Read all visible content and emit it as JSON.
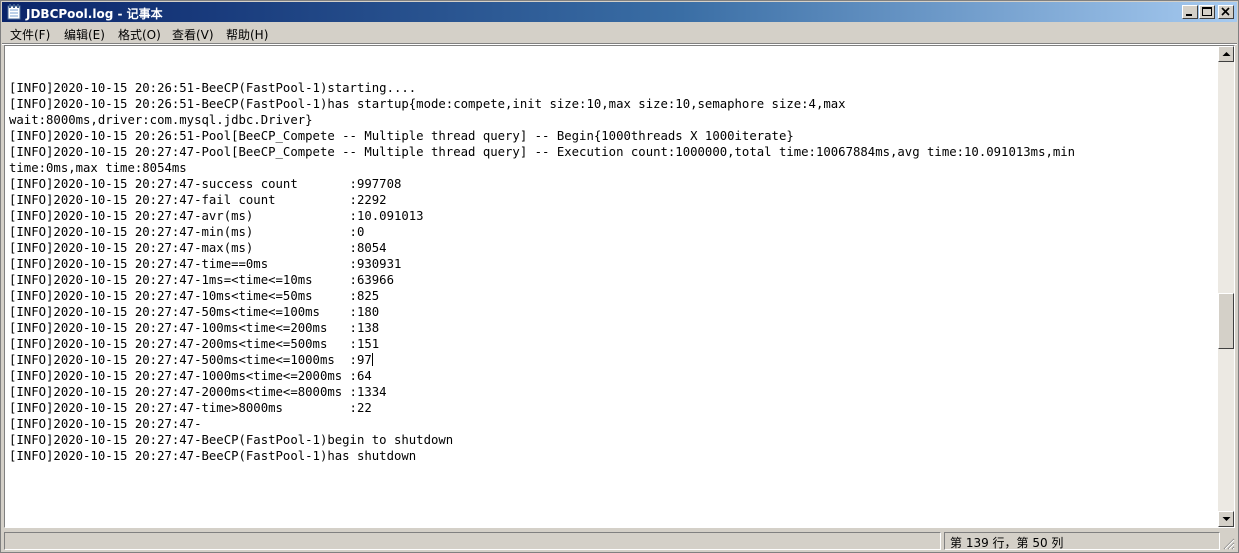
{
  "window": {
    "title": "JDBCPool.log - 记事本",
    "controls": {
      "minimize_icon": "minimize-icon",
      "maximize_icon": "maximize-icon",
      "close_icon": "close-icon"
    }
  },
  "menu": [
    {
      "label": "文件(F)"
    },
    {
      "label": "编辑(E)"
    },
    {
      "label": "格式(O)"
    },
    {
      "label": "查看(V)"
    },
    {
      "label": "帮助(H)"
    }
  ],
  "content": {
    "lines": [
      "",
      "[INFO]2020-10-15 20:26:51-BeeCP(FastPool-1)starting....",
      "[INFO]2020-10-15 20:26:51-BeeCP(FastPool-1)has startup{mode:compete,init size:10,max size:10,semaphore size:4,max",
      "wait:8000ms,driver:com.mysql.jdbc.Driver}",
      "[INFO]2020-10-15 20:26:51-Pool[BeeCP_Compete -- Multiple thread query] -- Begin{1000threads X 1000iterate}",
      "[INFO]2020-10-15 20:27:47-Pool[BeeCP_Compete -- Multiple thread query] -- Execution count:1000000,total time:10067884ms,avg time:10.091013ms,min",
      "time:0ms,max time:8054ms",
      "[INFO]2020-10-15 20:27:47-success count       :997708",
      "[INFO]2020-10-15 20:27:47-fail count          :2292",
      "[INFO]2020-10-15 20:27:47-avr(ms)             :10.091013",
      "[INFO]2020-10-15 20:27:47-min(ms)             :0",
      "[INFO]2020-10-15 20:27:47-max(ms)             :8054",
      "[INFO]2020-10-15 20:27:47-time==0ms           :930931",
      "[INFO]2020-10-15 20:27:47-1ms=<time<=10ms     :63966",
      "[INFO]2020-10-15 20:27:47-10ms<time<=50ms     :825",
      "[INFO]2020-10-15 20:27:47-50ms<time<=100ms    :180",
      "[INFO]2020-10-15 20:27:47-100ms<time<=200ms   :138",
      "[INFO]2020-10-15 20:27:47-200ms<time<=500ms   :151",
      "[INFO]2020-10-15 20:27:47-500ms<time<=1000ms  :97",
      "[INFO]2020-10-15 20:27:47-1000ms<time<=2000ms :64",
      "[INFO]2020-10-15 20:27:47-2000ms<time<=8000ms :1334",
      "[INFO]2020-10-15 20:27:47-time>8000ms         :22",
      "[INFO]2020-10-15 20:27:47-",
      "[INFO]2020-10-15 20:27:47-BeeCP(FastPool-1)begin to shutdown",
      "[INFO]2020-10-15 20:27:47-BeeCP(FastPool-1)has shutdown"
    ],
    "caret_line_index": 18
  },
  "scrollbar": {
    "up_icon": "scroll-up-arrow-icon",
    "down_icon": "scroll-down-arrow-icon"
  },
  "status": {
    "position": "第 139 行，第 50 列"
  }
}
